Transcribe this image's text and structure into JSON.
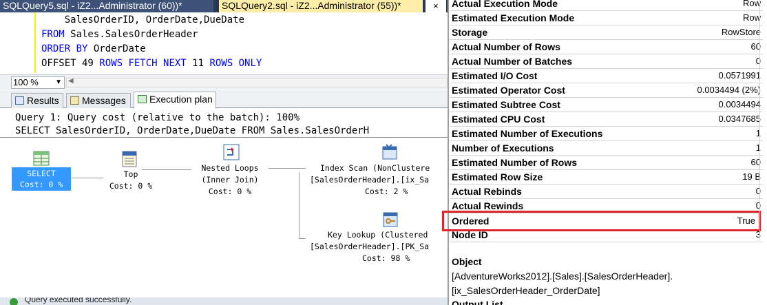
{
  "tabs": {
    "inactive": "SQLQuery5.sql - iZ2...Administrator (60))*",
    "active": "SQLQuery2.sql - iZ2...Administrator (55))*",
    "close_glyph": "×"
  },
  "editor": {
    "lines": [
      {
        "plain": "    SalesOrderID, OrderDate,DueDate"
      },
      {
        "kw1": "FROM",
        "rest": " Sales.SalesOrderHeader"
      },
      {
        "kw1": "ORDER BY",
        "rest": " OrderDate"
      },
      {
        "plain": "OFFSET 49 ",
        "kw2": "ROWS FETCH NEXT",
        "mid": " 11 ",
        "kw3": "ROWS ONLY"
      }
    ]
  },
  "zoom": {
    "value": "100 %"
  },
  "result_tabs": [
    {
      "label": "Results"
    },
    {
      "label": "Messages"
    },
    {
      "label": "Execution plan"
    }
  ],
  "plan": {
    "query_line": "Query 1: Query cost (relative to the batch): 100%",
    "sql_line": "SELECT SalesOrderID, OrderDate,DueDate FROM Sales.SalesOrderH",
    "nodes": {
      "select": {
        "name": "SELECT",
        "cost": "Cost: 0 %"
      },
      "top": {
        "name": "Top",
        "cost": "Cost: 0 %"
      },
      "nested": {
        "name": "Nested Loops",
        "sub": "(Inner Join)",
        "cost": "Cost: 0 %"
      },
      "index_scan": {
        "name": "Index Scan (NonClustere",
        "sub": "[SalesOrderHeader].[ix_Sa",
        "cost": "Cost: 2 %"
      },
      "key_lookup": {
        "name": "Key Lookup (Clustered",
        "sub": "[SalesOrderHeader].[PK_Sa",
        "cost": "Cost: 98 %"
      }
    }
  },
  "status": {
    "text": "Query executed successfully."
  },
  "properties": {
    "rows": [
      {
        "name": "Actual Execution Mode",
        "value": "Row"
      },
      {
        "name": "Estimated Execution Mode",
        "value": "Row"
      },
      {
        "name": "Storage",
        "value": "RowStore"
      },
      {
        "name": "Actual Number of Rows",
        "value": "60"
      },
      {
        "name": "Actual Number of Batches",
        "value": "0"
      },
      {
        "name": "Estimated I/O Cost",
        "value": "0.0571991"
      },
      {
        "name": "Estimated Operator Cost",
        "value": "0.0034494 (2%)"
      },
      {
        "name": "Estimated Subtree Cost",
        "value": "0.0034494"
      },
      {
        "name": "Estimated CPU Cost",
        "value": "0.0347685"
      },
      {
        "name": "Estimated Number of Executions",
        "value": "1"
      },
      {
        "name": "Number of Executions",
        "value": "1"
      },
      {
        "name": "Estimated Number of Rows",
        "value": "60"
      },
      {
        "name": "Estimated Row Size",
        "value": "19 B"
      },
      {
        "name": "Actual Rebinds",
        "value": "0"
      },
      {
        "name": "Actual Rewinds",
        "value": "0"
      },
      {
        "name": "Ordered",
        "value": "True"
      },
      {
        "name": "Node ID",
        "value": "3"
      }
    ],
    "object_heading": "Object",
    "object_lines": [
      "[AdventureWorks2012].[Sales].[SalesOrderHeader].",
      "[ix_SalesOrderHeader_OrderDate]"
    ],
    "output_list": "Output List",
    "highlight_color": "#e0252b"
  }
}
